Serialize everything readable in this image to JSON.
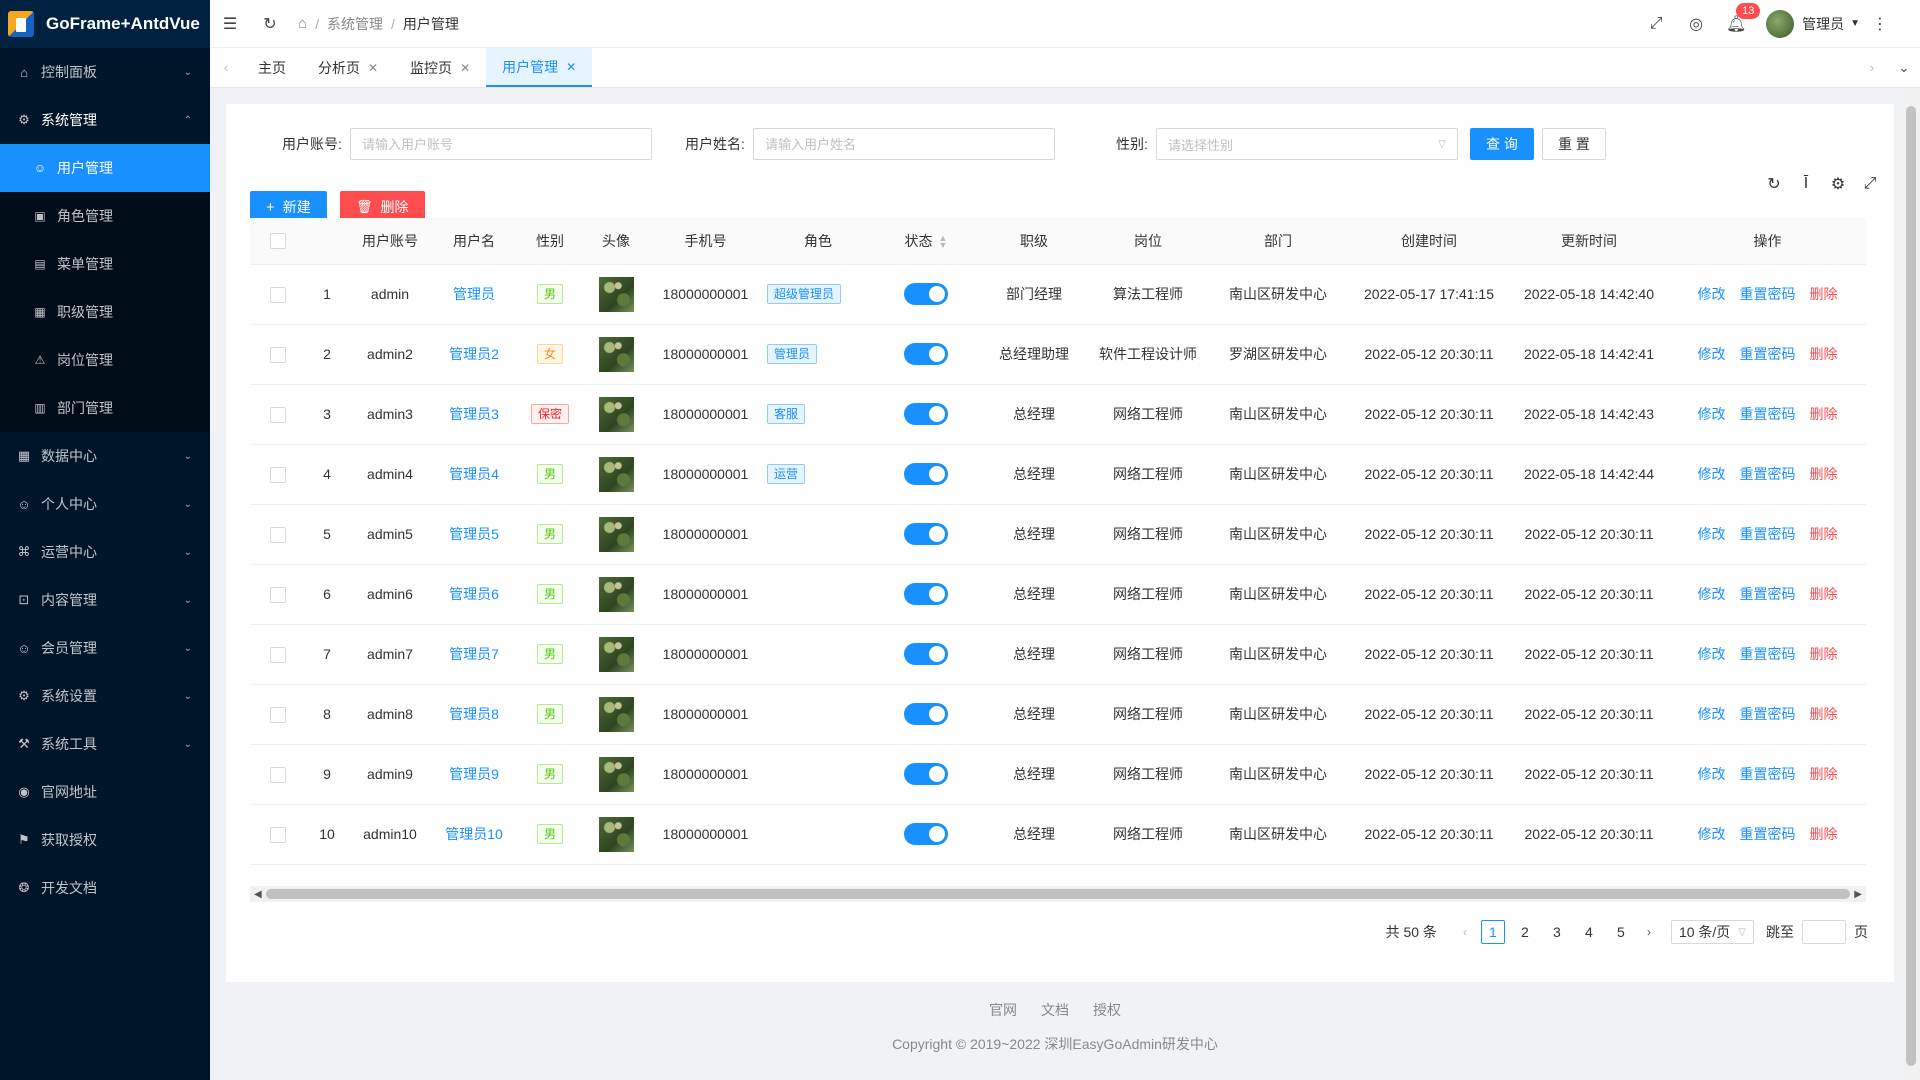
{
  "app": {
    "title": "GoFrame+AntdVue"
  },
  "sidebar": {
    "items": [
      {
        "label": "控制面板",
        "icon": "home-icon",
        "glyph": "⌂",
        "arrow": "⌄"
      },
      {
        "label": "系统管理",
        "icon": "gear-icon",
        "glyph": "⚙",
        "arrow": "⌃",
        "open": true,
        "children": [
          {
            "label": "用户管理",
            "icon": "user-icon",
            "glyph": "☺",
            "active": true
          },
          {
            "label": "角色管理",
            "icon": "role-icon",
            "glyph": "▣"
          },
          {
            "label": "菜单管理",
            "icon": "menu-icon",
            "glyph": "▤"
          },
          {
            "label": "职级管理",
            "icon": "level-icon",
            "glyph": "▦"
          },
          {
            "label": "岗位管理",
            "icon": "post-icon",
            "glyph": "⚠"
          },
          {
            "label": "部门管理",
            "icon": "dept-icon",
            "glyph": "▥"
          }
        ]
      },
      {
        "label": "数据中心",
        "icon": "grid-icon",
        "glyph": "▦",
        "arrow": "⌄"
      },
      {
        "label": "个人中心",
        "icon": "person-icon",
        "glyph": "☺",
        "arrow": "⌄"
      },
      {
        "label": "运营中心",
        "icon": "ops-icon",
        "glyph": "⌘",
        "arrow": "⌄"
      },
      {
        "label": "内容管理",
        "icon": "content-icon",
        "glyph": "⊡",
        "arrow": "⌄"
      },
      {
        "label": "会员管理",
        "icon": "member-icon",
        "glyph": "☺",
        "arrow": "⌄"
      },
      {
        "label": "系统设置",
        "icon": "settings-icon",
        "glyph": "⚙",
        "arrow": "⌄"
      },
      {
        "label": "系统工具",
        "icon": "tools-icon",
        "glyph": "⚒",
        "arrow": "⌄"
      },
      {
        "label": "官网地址",
        "icon": "globe-icon",
        "glyph": "◉"
      },
      {
        "label": "获取授权",
        "icon": "license-icon",
        "glyph": "⚑"
      },
      {
        "label": "开发文档",
        "icon": "docs-icon",
        "glyph": "❂"
      }
    ]
  },
  "header": {
    "breadcrumb": [
      "系统管理",
      "用户管理"
    ],
    "notification_count": "13",
    "user_name": "管理员"
  },
  "tabs": [
    {
      "label": "主页",
      "closable": false
    },
    {
      "label": "分析页",
      "closable": true
    },
    {
      "label": "监控页",
      "closable": true
    },
    {
      "label": "用户管理",
      "closable": true,
      "active": true
    }
  ],
  "search": {
    "account_label": "用户账号:",
    "account_placeholder": "请输入用户账号",
    "name_label": "用户姓名:",
    "name_placeholder": "请输入用户姓名",
    "gender_label": "性别:",
    "gender_placeholder": "请选择性别",
    "query_label": "查 询",
    "reset_label": "重 置"
  },
  "toolbar": {
    "new_label": "新建",
    "delete_label": "删除"
  },
  "table": {
    "columns": [
      "用户账号",
      "用户名",
      "性别",
      "头像",
      "手机号",
      "角色",
      "状态",
      "职级",
      "岗位",
      "部门",
      "创建时间",
      "更新时间",
      "操作"
    ],
    "actions": {
      "edit": "修改",
      "reset_pwd": "重置密码",
      "delete": "删除"
    },
    "rows": [
      {
        "no": "1",
        "account": "admin",
        "username": "管理员",
        "gender": "男",
        "gender_type": "m",
        "phone": "18000000001",
        "role": "超级管理员",
        "status": true,
        "level": "部门经理",
        "post": "算法工程师",
        "dept": "南山区研发中心",
        "created": "2022-05-17 17:41:15",
        "updated": "2022-05-18 14:42:40"
      },
      {
        "no": "2",
        "account": "admin2",
        "username": "管理员2",
        "gender": "女",
        "gender_type": "f",
        "phone": "18000000001",
        "role": "管理员",
        "status": true,
        "level": "总经理助理",
        "post": "软件工程设计师",
        "dept": "罗湖区研发中心",
        "created": "2022-05-12 20:30:11",
        "updated": "2022-05-18 14:42:41"
      },
      {
        "no": "3",
        "account": "admin3",
        "username": "管理员3",
        "gender": "保密",
        "gender_type": "s",
        "phone": "18000000001",
        "role": "客服",
        "status": true,
        "level": "总经理",
        "post": "网络工程师",
        "dept": "南山区研发中心",
        "created": "2022-05-12 20:30:11",
        "updated": "2022-05-18 14:42:43"
      },
      {
        "no": "4",
        "account": "admin4",
        "username": "管理员4",
        "gender": "男",
        "gender_type": "m",
        "phone": "18000000001",
        "role": "运营",
        "status": true,
        "level": "总经理",
        "post": "网络工程师",
        "dept": "南山区研发中心",
        "created": "2022-05-12 20:30:11",
        "updated": "2022-05-18 14:42:44"
      },
      {
        "no": "5",
        "account": "admin5",
        "username": "管理员5",
        "gender": "男",
        "gender_type": "m",
        "phone": "18000000001",
        "role": "",
        "status": true,
        "level": "总经理",
        "post": "网络工程师",
        "dept": "南山区研发中心",
        "created": "2022-05-12 20:30:11",
        "updated": "2022-05-12 20:30:11"
      },
      {
        "no": "6",
        "account": "admin6",
        "username": "管理员6",
        "gender": "男",
        "gender_type": "m",
        "phone": "18000000001",
        "role": "",
        "status": true,
        "level": "总经理",
        "post": "网络工程师",
        "dept": "南山区研发中心",
        "created": "2022-05-12 20:30:11",
        "updated": "2022-05-12 20:30:11"
      },
      {
        "no": "7",
        "account": "admin7",
        "username": "管理员7",
        "gender": "男",
        "gender_type": "m",
        "phone": "18000000001",
        "role": "",
        "status": true,
        "level": "总经理",
        "post": "网络工程师",
        "dept": "南山区研发中心",
        "created": "2022-05-12 20:30:11",
        "updated": "2022-05-12 20:30:11"
      },
      {
        "no": "8",
        "account": "admin8",
        "username": "管理员8",
        "gender": "男",
        "gender_type": "m",
        "phone": "18000000001",
        "role": "",
        "status": true,
        "level": "总经理",
        "post": "网络工程师",
        "dept": "南山区研发中心",
        "created": "2022-05-12 20:30:11",
        "updated": "2022-05-12 20:30:11"
      },
      {
        "no": "9",
        "account": "admin9",
        "username": "管理员9",
        "gender": "男",
        "gender_type": "m",
        "phone": "18000000001",
        "role": "",
        "status": true,
        "level": "总经理",
        "post": "网络工程师",
        "dept": "南山区研发中心",
        "created": "2022-05-12 20:30:11",
        "updated": "2022-05-12 20:30:11"
      },
      {
        "no": "10",
        "account": "admin10",
        "username": "管理员10",
        "gender": "男",
        "gender_type": "m",
        "phone": "18000000001",
        "role": "",
        "status": true,
        "level": "总经理",
        "post": "网络工程师",
        "dept": "南山区研发中心",
        "created": "2022-05-12 20:30:11",
        "updated": "2022-05-12 20:30:11"
      }
    ]
  },
  "pagination": {
    "total_text": "共 50 条",
    "pages": [
      "1",
      "2",
      "3",
      "4",
      "5"
    ],
    "current": "1",
    "page_size": "10 条/页",
    "jump_label": "跳至",
    "jump_suffix": "页"
  },
  "footer": {
    "links": [
      "官网",
      "文档",
      "授权"
    ],
    "copyright": "Copyright © 2019~2022 深圳EasyGoAdmin研发中心"
  }
}
